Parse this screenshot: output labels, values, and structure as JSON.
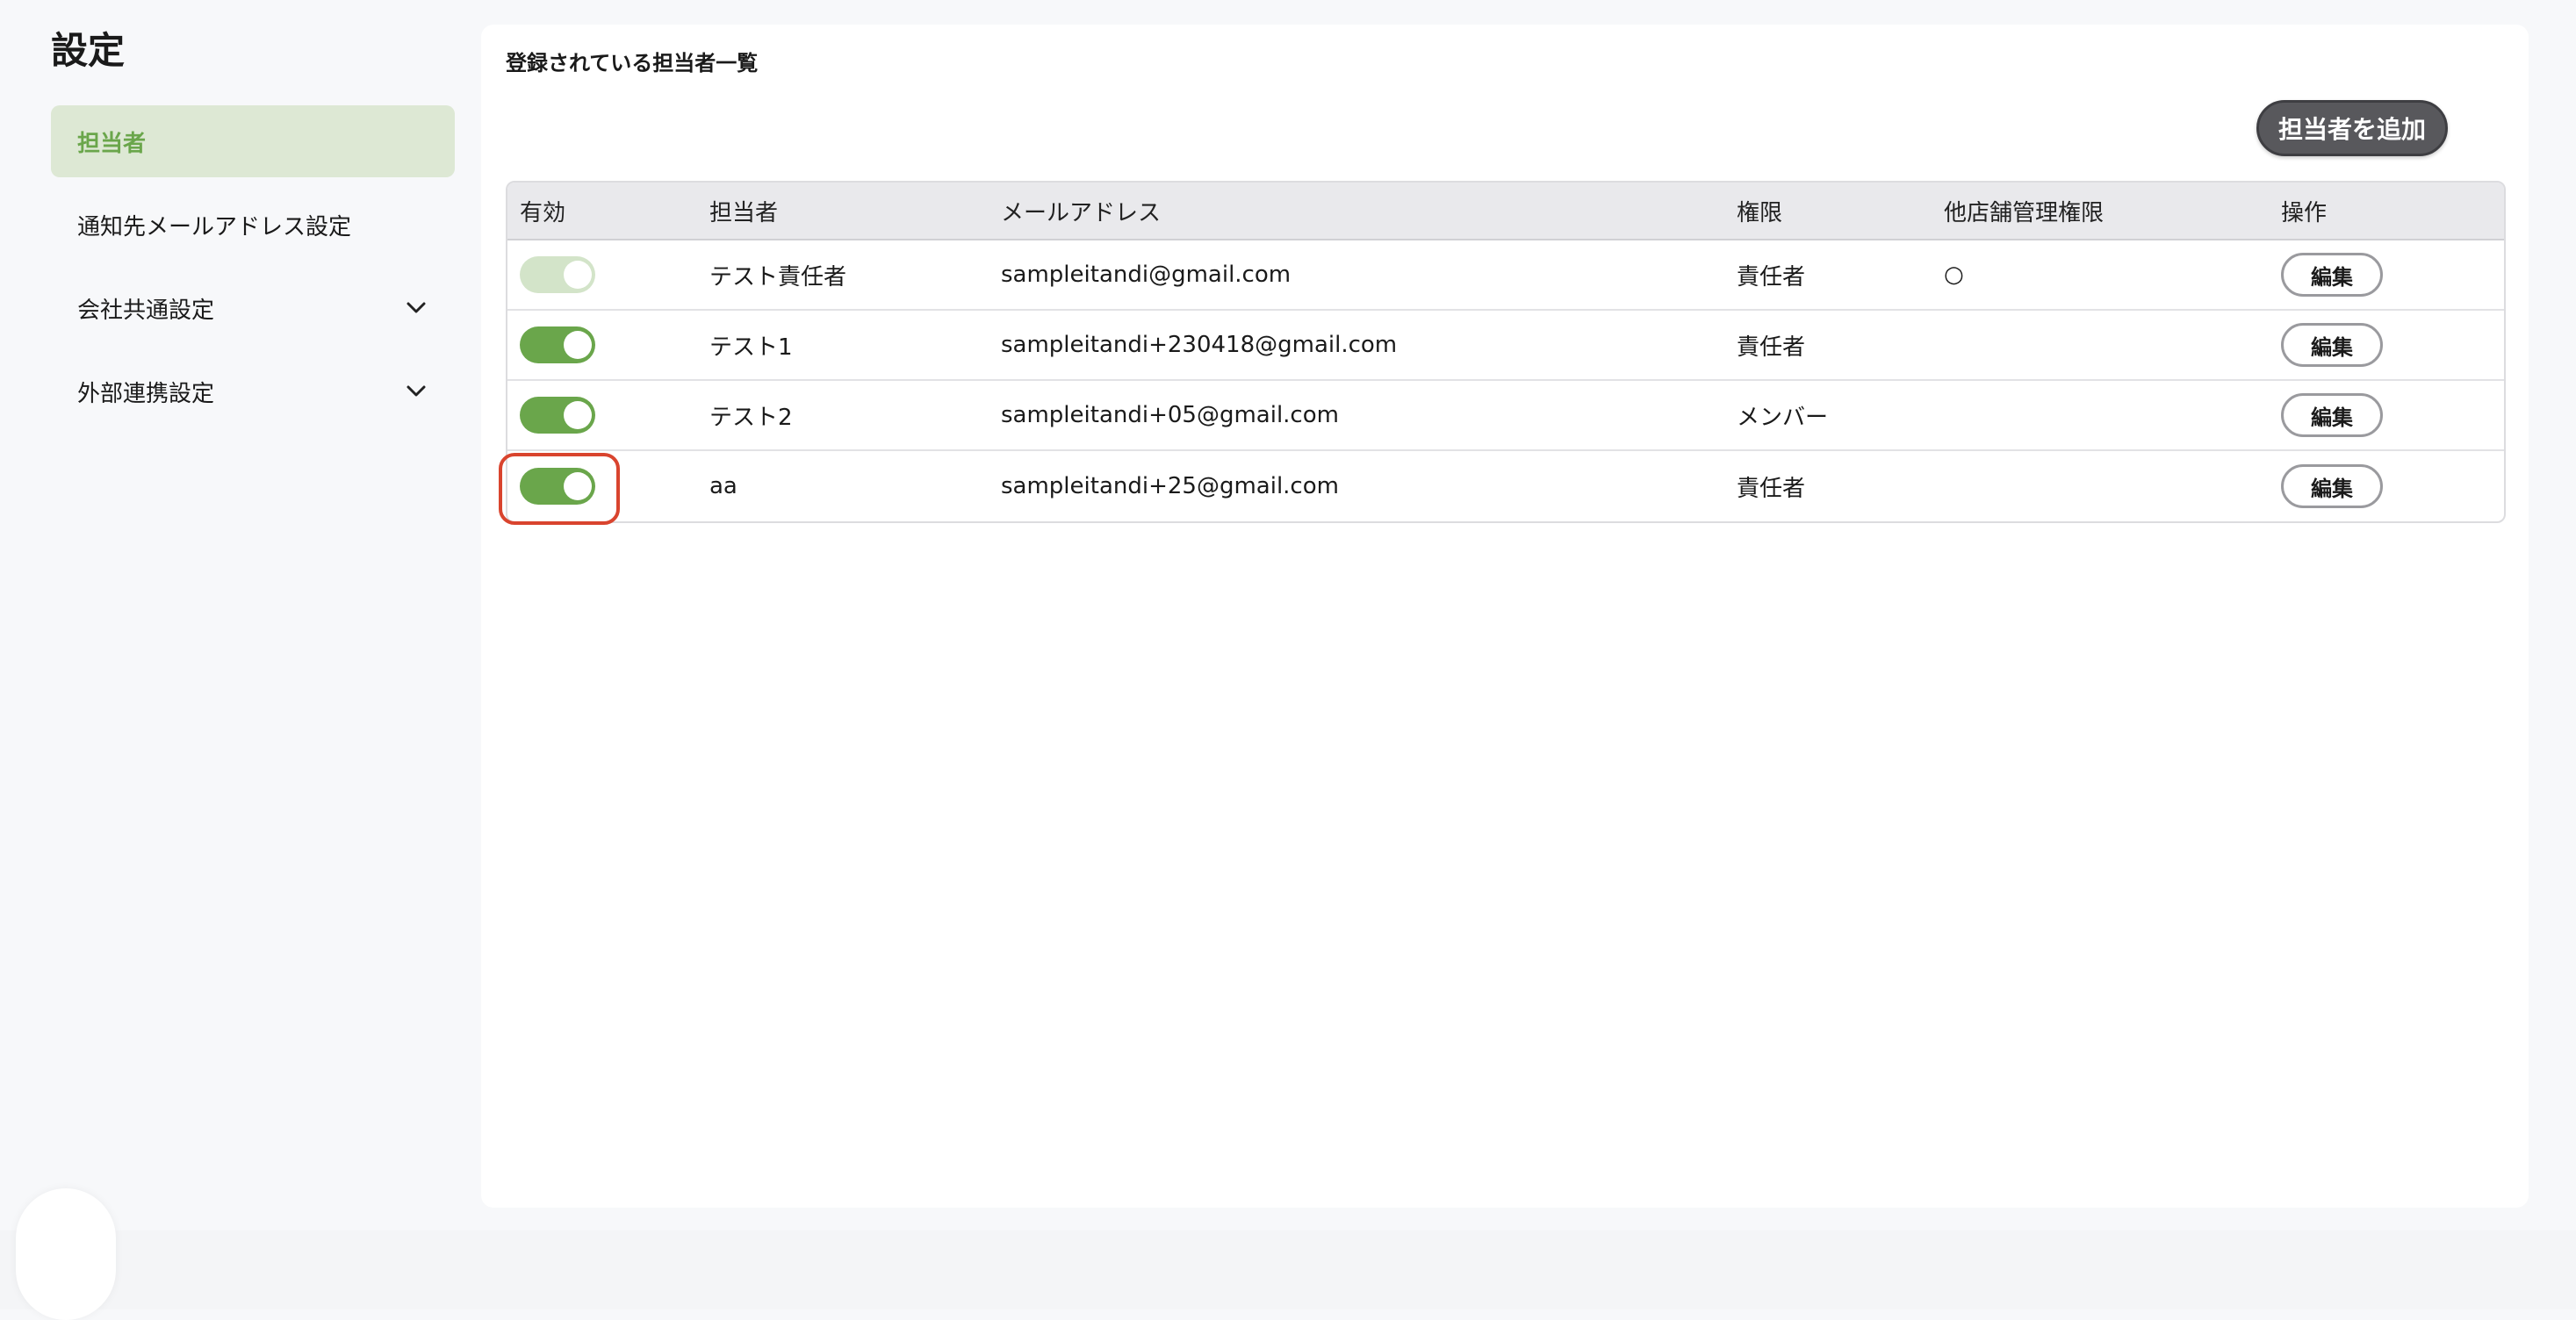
{
  "page": {
    "title": "設定"
  },
  "sidebar": {
    "items": [
      {
        "label": "担当者",
        "active": true
      },
      {
        "label": "通知先メールアドレス設定"
      },
      {
        "label": "会社共通設定",
        "icon": "chevron-down-icon"
      },
      {
        "label": "外部連携設定",
        "icon": "chevron-down-icon"
      }
    ]
  },
  "main": {
    "section_title": "登録されている担当者一覧",
    "add_button_label": "担当者を追加",
    "table": {
      "headers": [
        "有効",
        "担当者",
        "メールアドレス",
        "権限",
        "他店舗管理権限",
        "操作"
      ],
      "rows": [
        {
          "enabled": "on-disabled",
          "name": "テスト責任者",
          "email": "sampleitandi@gmail.com",
          "role": "責任者",
          "multi_store": "○",
          "action": "編集"
        },
        {
          "enabled": "on",
          "name": "テスト1",
          "email": "sampleitandi+230418@gmail.com",
          "role": "責任者",
          "multi_store": "",
          "action": "編集"
        },
        {
          "enabled": "on",
          "name": "テスト2",
          "email": "sampleitandi+05@gmail.com",
          "role": "メンバー",
          "multi_store": "",
          "action": "編集"
        },
        {
          "enabled": "on",
          "name": "aa",
          "email": "sampleitandi+25@gmail.com",
          "role": "責任者",
          "multi_store": "",
          "action": "編集"
        }
      ]
    }
  },
  "colors": {
    "accent_green": "#6aa64b",
    "active_nav_bg": "#dde8d4",
    "highlight_red": "#d9442e",
    "dark_button": "#58585c"
  }
}
